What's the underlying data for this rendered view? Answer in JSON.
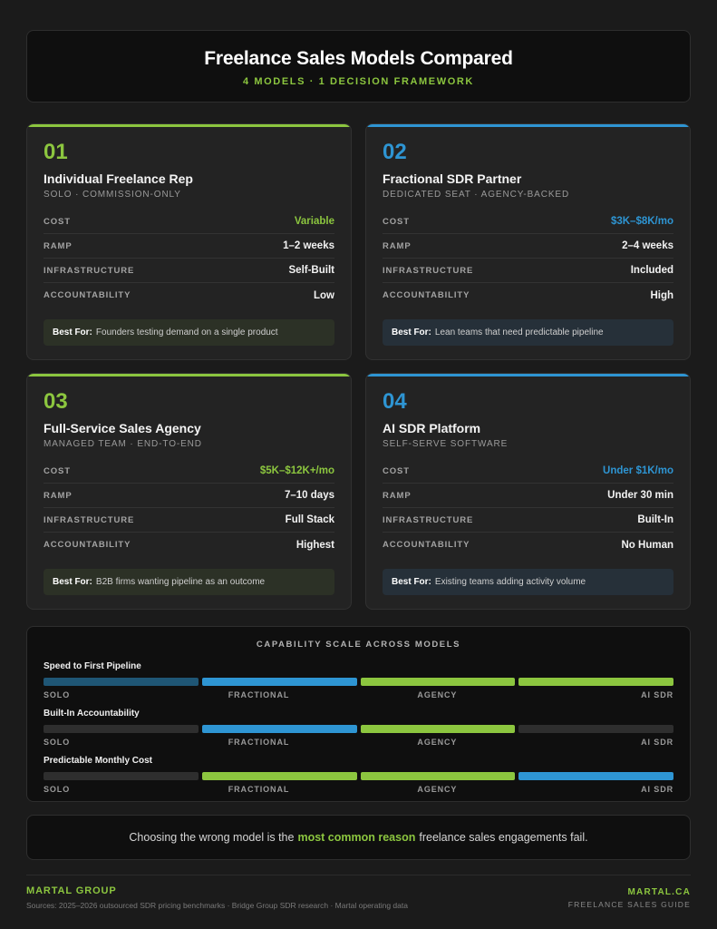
{
  "header": {
    "title": "Freelance Sales Models Compared",
    "subtitle": "4 MODELS · 1 DECISION FRAMEWORK"
  },
  "row_labels": {
    "cost": "COST",
    "ramp": "RAMP",
    "infrastructure": "INFRASTRUCTURE",
    "accountability": "ACCOUNTABILITY"
  },
  "best_for_label": "Best For:",
  "cards": [
    {
      "num": "01",
      "title": "Individual Freelance Rep",
      "kicker": "SOLO · COMMISSION-ONLY",
      "cost": "Variable",
      "ramp": "1–2 weeks",
      "infrastructure": "Self-Built",
      "accountability": "Low",
      "best_for": "Founders testing demand on a single product",
      "accent": "#8cc63f"
    },
    {
      "num": "02",
      "title": "Fractional SDR Partner",
      "kicker": "DEDICATED SEAT · AGENCY-BACKED",
      "cost": "$3K–$8K/mo",
      "ramp": "2–4 weeks",
      "infrastructure": "Included",
      "accountability": "High",
      "best_for": "Lean teams that need predictable pipeline",
      "accent": "#2e95d3"
    },
    {
      "num": "03",
      "title": "Full-Service Sales Agency",
      "kicker": "MANAGED TEAM · END-TO-END",
      "cost": "$5K–$12K+/mo",
      "ramp": "7–10 days",
      "infrastructure": "Full Stack",
      "accountability": "Highest",
      "best_for": "B2B firms wanting pipeline as an outcome",
      "accent": "#8cc63f"
    },
    {
      "num": "04",
      "title": "AI SDR Platform",
      "kicker": "SELF-SERVE SOFTWARE",
      "cost": "Under $1K/mo",
      "ramp": "Under 30 min",
      "infrastructure": "Built-In",
      "accountability": "No Human",
      "best_for": "Existing teams adding activity volume",
      "accent": "#2e95d3"
    }
  ],
  "scale": {
    "title": "CAPABILITY SCALE ACROSS MODELS",
    "model_labels": [
      "SOLO",
      "FRACTIONAL",
      "AGENCY",
      "AI SDR"
    ],
    "metrics": [
      {
        "name": "Speed to First Pipeline",
        "bar_colors": [
          "#1f5675",
          "#2e95d3",
          "#8cc63f",
          "#8cc63f"
        ]
      },
      {
        "name": "Built-In Accountability",
        "bar_colors": [
          "#2e2e2e",
          "#2e95d3",
          "#8cc63f",
          "#2e2e2e"
        ]
      },
      {
        "name": "Predictable Monthly Cost",
        "bar_colors": [
          "#2e2e2e",
          "#8cc63f",
          "#8cc63f",
          "#2e95d3"
        ]
      }
    ]
  },
  "callout": {
    "before": "Choosing the wrong model is the",
    "highlight": "most common reason",
    "after": "freelance sales engagements fail."
  },
  "footer": {
    "brand": "MARTAL GROUP",
    "sources": "Sources: 2025–2026 outsourced SDR pricing benchmarks · Bridge Group SDR research · Martal operating data",
    "site": "MARTAL.CA",
    "guide": "FREELANCE SALES GUIDE"
  }
}
